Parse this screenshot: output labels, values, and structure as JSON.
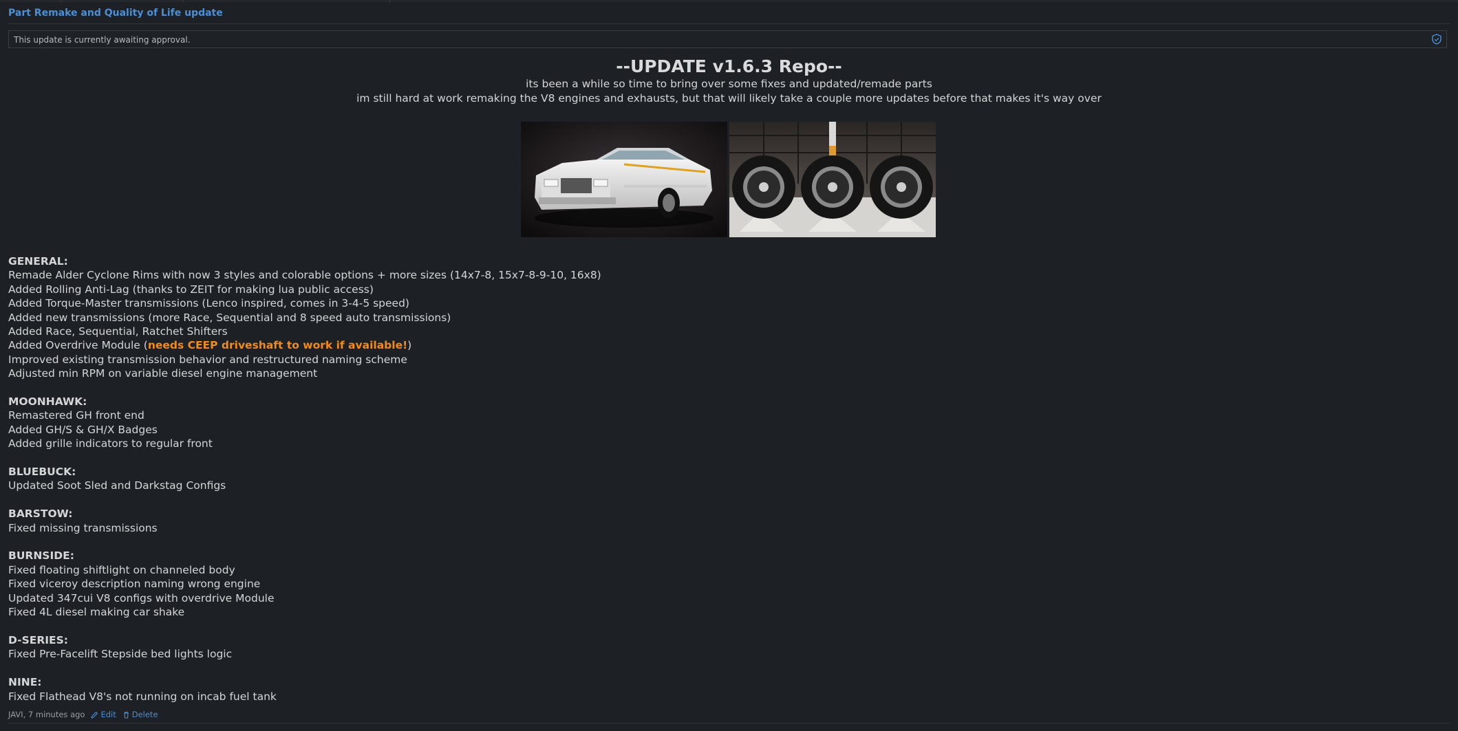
{
  "update": {
    "title": "Part Remake and Quality of Life update",
    "notice": "This update is currently awaiting approval."
  },
  "header": {
    "heading": "--UPDATE v1.6.3 Repo--",
    "intro1": "its been a while so time to bring over some fixes and updated/remade parts",
    "intro2": "im still hard at work remaking the V8 engines and exhausts, but that will likely take a couple more updates before that makes it's way over"
  },
  "images": [
    {
      "name": "car-screenshot"
    },
    {
      "name": "wheels-screenshot"
    }
  ],
  "sections": [
    {
      "title": "GENERAL:",
      "lines": [
        "Remade Alder Cyclone Rims with now 3 styles and colorable options + more sizes (14x7-8, 15x7-8-9-10, 16x8)",
        "Added Rolling Anti-Lag (thanks to ZEIT for making lua public access)",
        "Added Torque-Master transmissions (Lenco inspired, comes in 3-4-5 speed)",
        "Added new transmissions (more Race, Sequential and 8 speed auto transmissions)",
        "Added Race, Sequential, Ratchet Shifters",
        {
          "pre": "Added Overdrive Module (",
          "highlight": "needs CEEP driveshaft to work if available!",
          "post": ")"
        },
        "Improved existing transmission behavior and restructured naming scheme",
        "Adjusted min RPM on variable diesel engine management"
      ]
    },
    {
      "title": "MOONHAWK:",
      "lines": [
        "Remastered GH front end",
        "Added GH/S & GH/X Badges",
        "Added grille indicators to regular front"
      ]
    },
    {
      "title": "BLUEBUCK:",
      "lines": [
        "Updated Soot Sled and Darkstag Configs"
      ]
    },
    {
      "title": "BARSTOW:",
      "lines": [
        "Fixed missing transmissions"
      ]
    },
    {
      "title": "BURNSIDE:",
      "lines": [
        "Fixed floating shiftlight on channeled body",
        "Fixed viceroy description naming wrong engine",
        "Updated 347cui V8 configs with overdrive Module",
        "Fixed 4L diesel making car shake"
      ]
    },
    {
      "title": "D-SERIES:",
      "lines": [
        "Fixed Pre-Facelift Stepside bed lights logic"
      ]
    },
    {
      "title": "NINE:",
      "lines": [
        "Fixed Flathead V8's not running on incab fuel tank"
      ]
    }
  ],
  "footer": {
    "meta": "JAVI, 7 minutes ago",
    "edit_label": "Edit",
    "delete_label": "Delete"
  },
  "colors": {
    "background": "#1d2024",
    "link": "#4a8fd6",
    "warning": "#f08c1a",
    "text": "#d4d6d8"
  },
  "icons": [
    "shield-check-icon",
    "pencil-icon",
    "trash-icon"
  ]
}
